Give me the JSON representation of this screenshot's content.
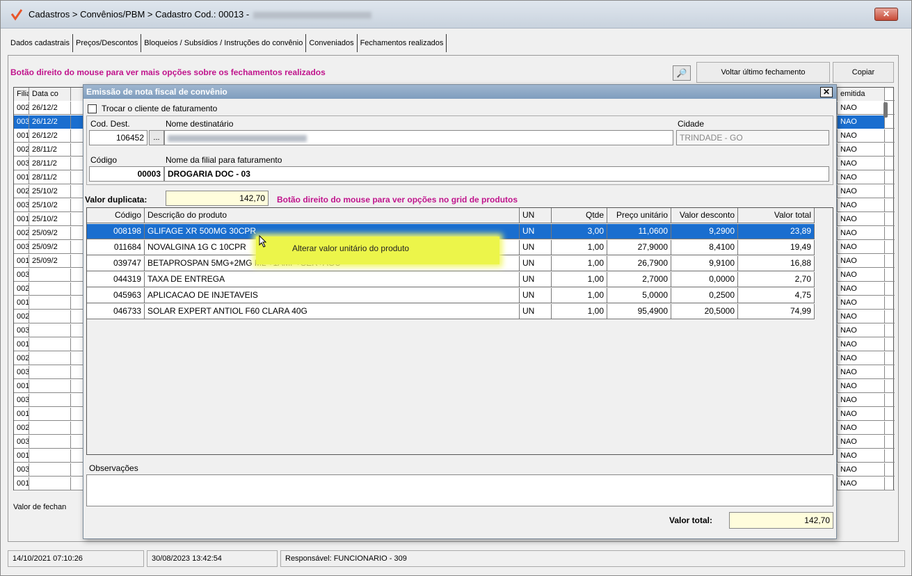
{
  "window": {
    "title": "Cadastros > Convênios/PBM > Cadastro  Cod.: 00013 -",
    "close_label": "✕"
  },
  "tabs": [
    {
      "label": "Dados cadastrais"
    },
    {
      "label": "Preços/Descontos"
    },
    {
      "label": "Bloqueios / Subsídios / Instruções do convênio"
    },
    {
      "label": "Conveniados"
    },
    {
      "label": "Fechamentos realizados"
    }
  ],
  "main": {
    "hint": "Botão direito do mouse para ver mais opções sobre os fechamentos realizados",
    "search_icon": "magnifier-icon",
    "voltar_label": "Voltar último fechamento",
    "copiar_label": "Copiar",
    "valor_fechamento_label": "Valor de fechan",
    "grid_headers": {
      "filial": "Filial",
      "data": "Data co",
      "emitida": "emitida"
    },
    "grid_rows": [
      {
        "filial": "002",
        "data": "26/12/2",
        "emitida": "NAO"
      },
      {
        "filial": "003",
        "data": "26/12/2",
        "emitida": "NAO"
      },
      {
        "filial": "001",
        "data": "26/12/2",
        "emitida": "NAO"
      },
      {
        "filial": "002",
        "data": "28/11/2",
        "emitida": "NAO"
      },
      {
        "filial": "003",
        "data": "28/11/2",
        "emitida": "NAO"
      },
      {
        "filial": "001",
        "data": "28/11/2",
        "emitida": "NAO"
      },
      {
        "filial": "002",
        "data": "25/10/2",
        "emitida": "NAO"
      },
      {
        "filial": "003",
        "data": "25/10/2",
        "emitida": "NAO"
      },
      {
        "filial": "001",
        "data": "25/10/2",
        "emitida": "NAO"
      },
      {
        "filial": "002",
        "data": "25/09/2",
        "emitida": "NAO"
      },
      {
        "filial": "003",
        "data": "25/09/2",
        "emitida": "NAO"
      },
      {
        "filial": "001",
        "data": "25/09/2",
        "emitida": "NAO"
      },
      {
        "filial": "003",
        "data": "",
        "emitida": "NAO"
      },
      {
        "filial": "002",
        "data": "",
        "emitida": "NAO"
      },
      {
        "filial": "001",
        "data": "",
        "emitida": "NAO"
      },
      {
        "filial": "002",
        "data": "",
        "emitida": "NAO"
      },
      {
        "filial": "003",
        "data": "",
        "emitida": "NAO"
      },
      {
        "filial": "001",
        "data": "",
        "emitida": "NAO"
      },
      {
        "filial": "002",
        "data": "",
        "emitida": "NAO"
      },
      {
        "filial": "003",
        "data": "",
        "emitida": "NAO"
      },
      {
        "filial": "001",
        "data": "",
        "emitida": "NAO"
      },
      {
        "filial": "003",
        "data": "",
        "emitida": "NAO"
      },
      {
        "filial": "001",
        "data": "",
        "emitida": "NAO"
      },
      {
        "filial": "002",
        "data": "",
        "emitida": "NAO"
      },
      {
        "filial": "003",
        "data": "",
        "emitida": "NAO"
      },
      {
        "filial": "001",
        "data": "",
        "emitida": "NAO"
      },
      {
        "filial": "003",
        "data": "",
        "emitida": "NAO"
      },
      {
        "filial": "001",
        "data": "",
        "emitida": "NAO"
      }
    ],
    "selected_row": 1
  },
  "status": {
    "left": "14/10/2021 07:10:26",
    "middle": "30/08/2023 13:42:54",
    "right": "Responsável: FUNCIONARIO - 309"
  },
  "dialog": {
    "title": "Emissão de nota fiscal de convênio",
    "close_label": "✕",
    "checkbox_label": "Trocar o cliente de faturamento",
    "cod_dest_label": "Cod. Dest.",
    "cod_dest_value": "106452",
    "dots_label": "...",
    "nome_dest_label": "Nome destinatário",
    "cidade_label": "Cidade",
    "cidade_value": "TRINDADE - GO",
    "codigo_label": "Código",
    "codigo_value": "00003",
    "filial_label": "Nome da filial para faturamento",
    "filial_value": "DROGARIA DOC - 03",
    "valor_duplicata_label": "Valor duplicata:",
    "valor_duplicata_value": "142,70",
    "hint": "Botão direito do mouse para ver opções no grid de produtos",
    "grid_headers": {
      "codigo": "Código",
      "descricao": "Descrição do produto",
      "un": "UN",
      "qtde": "Qtde",
      "preco": "Preço unitário",
      "desconto": "Valor desconto",
      "total": "Valor total"
    },
    "products": [
      {
        "codigo": "008198",
        "descricao": "GLIFAGE XR 500MG 30CPR",
        "un": "UN",
        "qtde": "3,00",
        "preco": "11,0600",
        "desconto": "9,2900",
        "total": "23,89"
      },
      {
        "codigo": "011684",
        "descricao": "NOVALGINA 1G C 10CPR",
        "un": "UN",
        "qtde": "1,00",
        "preco": "27,9000",
        "desconto": "8,4100",
        "total": "19,49"
      },
      {
        "codigo": "039747",
        "descricao": "BETAPROSPAN 5MG+2MG ML +1AMP+SER+AGU",
        "un": "UN",
        "qtde": "1,00",
        "preco": "26,7900",
        "desconto": "9,9100",
        "total": "16,88"
      },
      {
        "codigo": "044319",
        "descricao": "TAXA DE ENTREGA",
        "un": "UN",
        "qtde": "1,00",
        "preco": "2,7000",
        "desconto": "0,0000",
        "total": "2,70"
      },
      {
        "codigo": "045963",
        "descricao": "APLICACAO DE INJETAVEIS",
        "un": "UN",
        "qtde": "1,00",
        "preco": "5,0000",
        "desconto": "0,2500",
        "total": "4,75"
      },
      {
        "codigo": "046733",
        "descricao": "SOLAR EXPERT ANTIOL F60 CLARA 40G",
        "un": "UN",
        "qtde": "1,00",
        "preco": "95,4900",
        "desconto": "20,5000",
        "total": "74,99"
      }
    ],
    "selected_product": 0,
    "context_menu_item": "Alterar valor unitário do produto",
    "observacoes_label": "Observações",
    "valor_total_label": "Valor total:",
    "valor_total_value": "142,70"
  },
  "colors": {
    "selection": "#1a6ecf",
    "hint": "#c0148c",
    "highlight": "#ecf54a"
  }
}
